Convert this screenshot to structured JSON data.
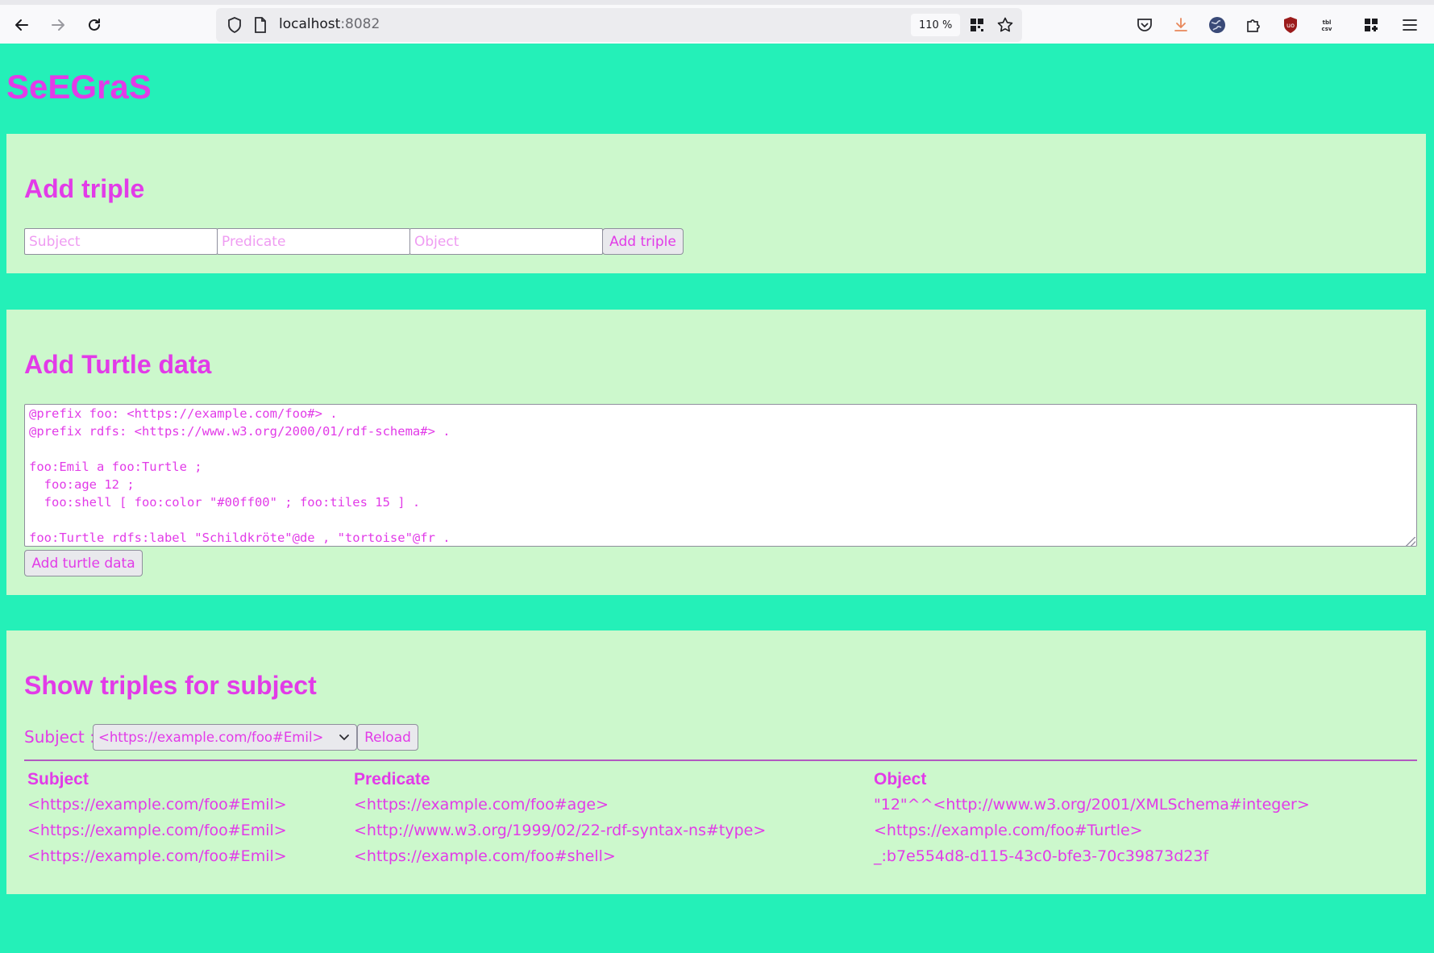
{
  "browser": {
    "url_host": "localhost",
    "url_port": ":8082",
    "zoom": "110 %"
  },
  "page": {
    "title": "SeEGraS"
  },
  "add_triple": {
    "heading": "Add triple",
    "subject_placeholder": "Subject",
    "predicate_placeholder": "Predicate",
    "object_placeholder": "Object",
    "button_label": "Add triple"
  },
  "add_turtle": {
    "heading": "Add Turtle data",
    "text": "@prefix foo: <https://example.com/foo#> .\n@prefix rdfs: <https://www.w3.org/2000/01/rdf-schema#> .\n\nfoo:Emil a foo:Turtle ;\n  foo:age 12 ;\n  foo:shell [ foo:color \"#00ff00\" ; foo:tiles 15 ] .\n\nfoo:Turtle rdfs:label \"Schildkröte\"@de , \"tortoise\"@fr .",
    "button_label": "Add turtle data"
  },
  "show_triples": {
    "heading": "Show triples for subject",
    "subject_label": "Subject :",
    "selected_subject": "<https://example.com/foo#Emil>",
    "reload_label": "Reload",
    "columns": [
      "Subject",
      "Predicate",
      "Object"
    ],
    "rows": [
      [
        "<https://example.com/foo#Emil>",
        "<https://example.com/foo#age>",
        "\"12\"^^<http://www.w3.org/2001/XMLSchema#integer>"
      ],
      [
        "<https://example.com/foo#Emil>",
        "<http://www.w3.org/1999/02/22-rdf-syntax-ns#type>",
        "<https://example.com/foo#Turtle>"
      ],
      [
        "<https://example.com/foo#Emil>",
        "<https://example.com/foo#shell>",
        "_:b7e554d8-d115-43c0-bfe3-70c39873d23f"
      ]
    ]
  },
  "colors": {
    "page_background": "#24f0b8",
    "panel_background": "#ccf8cc",
    "accent": "#e23be8"
  },
  "icons": {
    "back": "arrow-left-icon",
    "forward": "arrow-right-icon",
    "reload": "reload-icon",
    "shield": "shield-icon",
    "page": "page-icon",
    "qr": "qr-code-icon",
    "bookmark": "star-icon",
    "pocket": "pocket-icon",
    "download": "download-icon",
    "globe": "globe-icon",
    "extensions": "puzzle-icon",
    "ublock": "ublock-icon",
    "csv": "csv-icon",
    "apps": "apps-icon",
    "menu": "hamburger-menu-icon"
  }
}
